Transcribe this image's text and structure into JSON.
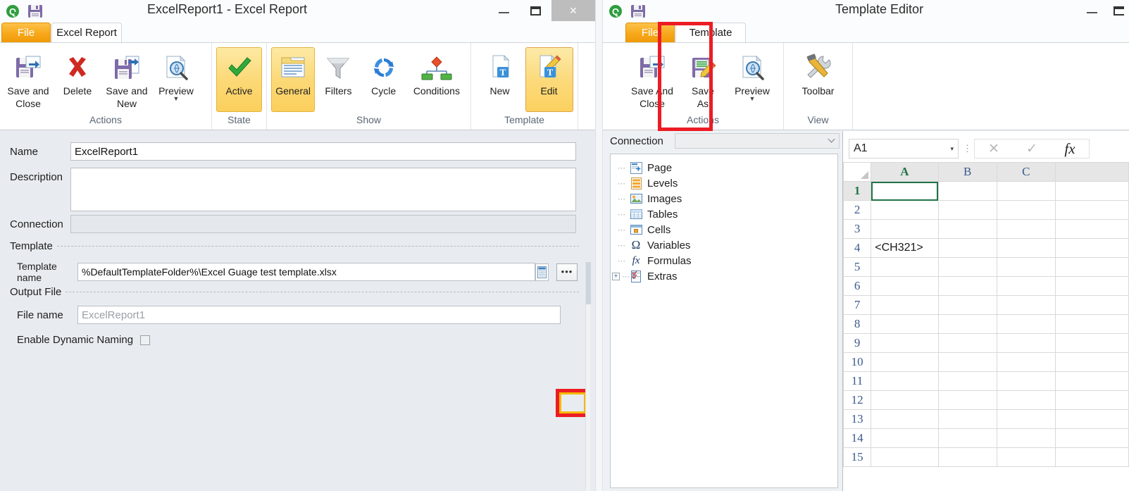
{
  "left_window": {
    "title": "ExcelReport1 - Excel Report",
    "quick_access": {
      "app_icon": "q-logo-icon",
      "save_icon": "save-icon"
    },
    "window_controls": {
      "minimize": "minimize-icon",
      "maximize": "maximize-icon",
      "close": "×"
    },
    "ribbon_helpers": {
      "collapse": "chevron-up-icon",
      "help": "help-icon"
    },
    "tabs": [
      {
        "label": "File",
        "id": "file",
        "active": false
      },
      {
        "label": "Excel Report",
        "id": "excel-report",
        "active": true
      }
    ],
    "ribbon_groups": [
      {
        "title": "Actions",
        "buttons": [
          {
            "label_line1": "Save and",
            "label_line2": "Close",
            "icon": "save-and-close-icon",
            "state": "normal"
          },
          {
            "label_line1": "Delete",
            "label_line2": "",
            "icon": "delete-x-icon",
            "state": "normal"
          },
          {
            "label_line1": "Save and",
            "label_line2": "New",
            "icon": "save-and-new-icon",
            "state": "normal"
          },
          {
            "label_line1": "Preview",
            "label_line2": "",
            "icon": "preview-magnifier-icon",
            "state": "normal",
            "has_dropdown": true
          }
        ]
      },
      {
        "title": "State",
        "buttons": [
          {
            "label_line1": "Active",
            "label_line2": "",
            "icon": "green-check-icon",
            "state": "selected"
          }
        ]
      },
      {
        "title": "Show",
        "buttons": [
          {
            "label_line1": "General",
            "label_line2": "",
            "icon": "general-window-icon",
            "state": "selected"
          },
          {
            "label_line1": "Filters",
            "label_line2": "",
            "icon": "filter-funnel-icon",
            "state": "normal"
          },
          {
            "label_line1": "Cycle",
            "label_line2": "",
            "icon": "cycle-refresh-icon",
            "state": "normal"
          },
          {
            "label_line1": "Conditions",
            "label_line2": "",
            "icon": "conditions-tree-icon",
            "state": "normal"
          }
        ]
      },
      {
        "title": "Template",
        "buttons": [
          {
            "label_line1": "New",
            "label_line2": "",
            "icon": "new-template-icon",
            "state": "normal"
          },
          {
            "label_line1": "Edit",
            "label_line2": "",
            "icon": "edit-template-pencil-icon",
            "state": "selected"
          }
        ]
      }
    ],
    "form": {
      "name_label": "Name",
      "name_value": "ExcelReport1",
      "description_label": "Description",
      "description_value": "",
      "connection_label": "Connection",
      "connection_value": "",
      "template_section": "Template",
      "template_name_label": "Template name",
      "template_name_value": "%DefaultTemplateFolder%\\Excel Guage test template.xlsx",
      "template_picker_icon": "list-picker-icon",
      "template_browse_label": "•••",
      "output_section": "Output File",
      "file_name_label": "File name",
      "file_name_placeholder": "ExcelReport1",
      "dynamic_naming_label": "Enable Dynamic Naming",
      "dynamic_naming_checked": false
    },
    "highlight": {
      "color": "#ec1c24",
      "inner_color": "#f5b800",
      "target": "template-browse-button"
    }
  },
  "right_window": {
    "title": "Template Editor",
    "quick_access": {
      "app_icon": "q-logo-icon",
      "save_icon": "save-icon"
    },
    "window_controls": {
      "minimize": "minimize-icon",
      "maximize": "maximize-icon"
    },
    "tabs": [
      {
        "label": "File",
        "id": "file",
        "active": false
      },
      {
        "label": "Template",
        "id": "template",
        "active": true
      }
    ],
    "ribbon_groups": [
      {
        "title": "Actions",
        "buttons": [
          {
            "label_line1": "Save And",
            "label_line2": "Close",
            "icon": "save-and-close-icon",
            "state": "normal"
          },
          {
            "label_line1": "Save",
            "label_line2": "As",
            "icon": "save-as-pencil-icon",
            "state": "normal",
            "highlighted": true
          },
          {
            "label_line1": "Preview",
            "label_line2": "",
            "icon": "preview-magnifier-icon",
            "state": "normal",
            "has_dropdown": true
          }
        ]
      },
      {
        "title": "View",
        "buttons": [
          {
            "label_line1": "Toolbar",
            "label_line2": "",
            "icon": "tools-wrench-hammer-icon",
            "state": "normal"
          }
        ]
      }
    ],
    "connection": {
      "label": "Connection",
      "value": "",
      "dropdown_icon": "chevron-down-icon"
    },
    "tree_items": [
      {
        "label": "Page",
        "icon": "page-add-icon",
        "expandable": false
      },
      {
        "label": "Levels",
        "icon": "levels-icon",
        "expandable": false
      },
      {
        "label": "Images",
        "icon": "images-icon",
        "expandable": false
      },
      {
        "label": "Tables",
        "icon": "tables-grid-icon",
        "expandable": false
      },
      {
        "label": "Cells",
        "icon": "cells-icon",
        "expandable": false
      },
      {
        "label": "Variables",
        "icon": "omega-variables-icon",
        "expandable": false
      },
      {
        "label": "Formulas",
        "icon": "fx-formulas-icon",
        "expandable": false
      },
      {
        "label": "Extras",
        "icon": "extras-checklist-icon",
        "expandable": true,
        "expander": "+"
      }
    ],
    "highlight": {
      "color": "#ec1c24",
      "target": "save-as-button"
    },
    "spreadsheet": {
      "name_box_value": "A1",
      "name_box_caret": "▾",
      "formula_buttons": [
        {
          "label": "✕",
          "name": "cancel-formula-icon"
        },
        {
          "label": "✓",
          "name": "confirm-formula-icon"
        },
        {
          "label": "fx",
          "name": "insert-function-icon"
        }
      ],
      "columns": [
        "A",
        "B",
        "C"
      ],
      "selected_cell": "A1",
      "rows": [
        {
          "num": "1",
          "cells": [
            "",
            "",
            ""
          ]
        },
        {
          "num": "2",
          "cells": [
            "",
            "",
            ""
          ]
        },
        {
          "num": "3",
          "cells": [
            "",
            "",
            ""
          ]
        },
        {
          "num": "4",
          "cells": [
            "<CH321>",
            "",
            ""
          ]
        },
        {
          "num": "5",
          "cells": [
            "",
            "",
            ""
          ]
        },
        {
          "num": "6",
          "cells": [
            "",
            "",
            ""
          ]
        },
        {
          "num": "7",
          "cells": [
            "",
            "",
            ""
          ]
        },
        {
          "num": "8",
          "cells": [
            "",
            "",
            ""
          ]
        },
        {
          "num": "9",
          "cells": [
            "",
            "",
            ""
          ]
        },
        {
          "num": "10",
          "cells": [
            "",
            "",
            ""
          ]
        },
        {
          "num": "11",
          "cells": [
            "",
            "",
            ""
          ]
        },
        {
          "num": "12",
          "cells": [
            "",
            "",
            ""
          ]
        },
        {
          "num": "13",
          "cells": [
            "",
            "",
            ""
          ]
        },
        {
          "num": "14",
          "cells": [
            "",
            "",
            ""
          ]
        },
        {
          "num": "15",
          "cells": [
            "",
            "",
            ""
          ]
        }
      ]
    }
  }
}
